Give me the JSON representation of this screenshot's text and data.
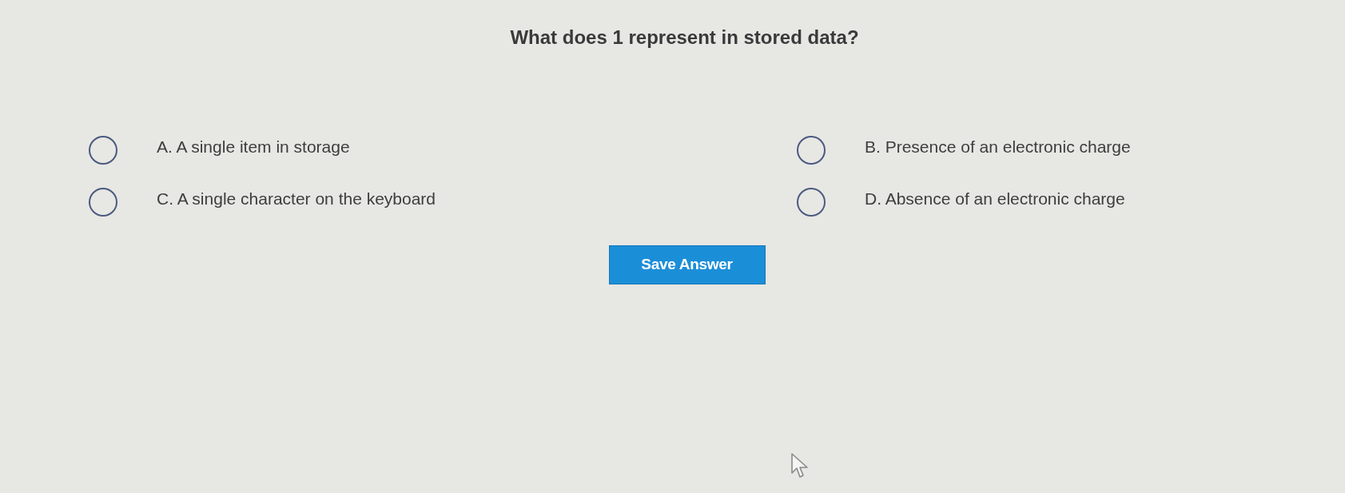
{
  "question": "What does 1 represent in stored data?",
  "options": [
    {
      "label": "A. A single item in storage",
      "selected": false
    },
    {
      "label": "B. Presence of an electronic charge",
      "selected": false
    },
    {
      "label": "C. A single character on the keyboard",
      "selected": false
    },
    {
      "label": "D. Absence of an electronic charge",
      "selected": false
    }
  ],
  "save_button": {
    "label": "Save Answer"
  }
}
